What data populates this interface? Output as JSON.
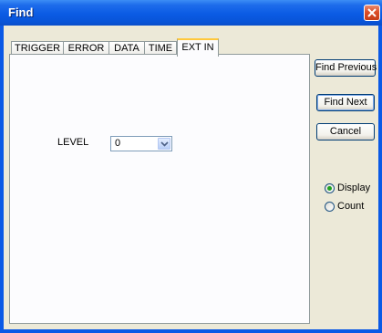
{
  "window": {
    "title": "Find"
  },
  "tabs": [
    {
      "label": "TRIGGER"
    },
    {
      "label": "ERROR"
    },
    {
      "label": "DATA"
    },
    {
      "label": "TIME"
    },
    {
      "label": "EXT IN",
      "active": true
    }
  ],
  "ext_in": {
    "level_label": "LEVEL",
    "level_value": "0"
  },
  "buttons": {
    "find_previous": "Find Previous",
    "find_next": "Find Next",
    "cancel": "Cancel"
  },
  "options": {
    "display_label": "Display",
    "count_label": "Count",
    "selected": "Display"
  },
  "icons": {
    "close": "close-icon",
    "dropdown": "chevron-down-icon"
  },
  "colors": {
    "titlebar": "#0A59E6",
    "dialog_bg": "#ECE9D8",
    "close_button": "#DC4E29",
    "active_tab_accent": "#FFC83C",
    "radio_dot": "#21A121"
  }
}
